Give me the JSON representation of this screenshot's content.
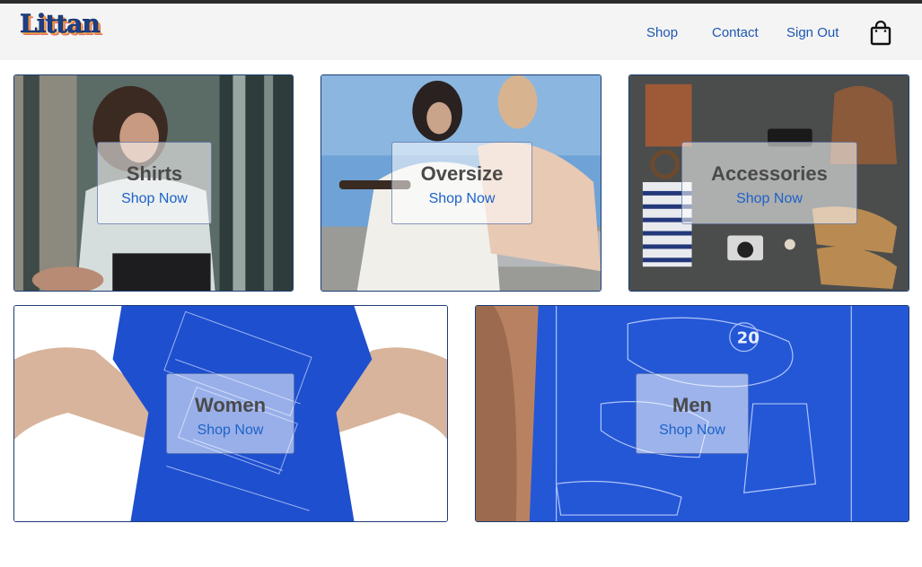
{
  "header": {
    "logo_text": "Littan",
    "nav": {
      "shop": "Shop",
      "contact": "Contact",
      "sign_out": "Sign Out"
    }
  },
  "categories": [
    {
      "title": "Shirts",
      "link": "Shop Now"
    },
    {
      "title": "Oversize",
      "link": "Shop Now"
    },
    {
      "title": "Accessories",
      "link": "Shop Now"
    },
    {
      "title": "Women",
      "link": "Shop Now"
    },
    {
      "title": "Men",
      "link": "Shop Now"
    }
  ],
  "colors": {
    "accent": "#1d62c8",
    "brand": "#1d3f86",
    "tile_border": "#1c3d73",
    "tshirt_blue": "#1e4fcf"
  },
  "icons": {
    "cart": "shopping-bag-icon"
  }
}
